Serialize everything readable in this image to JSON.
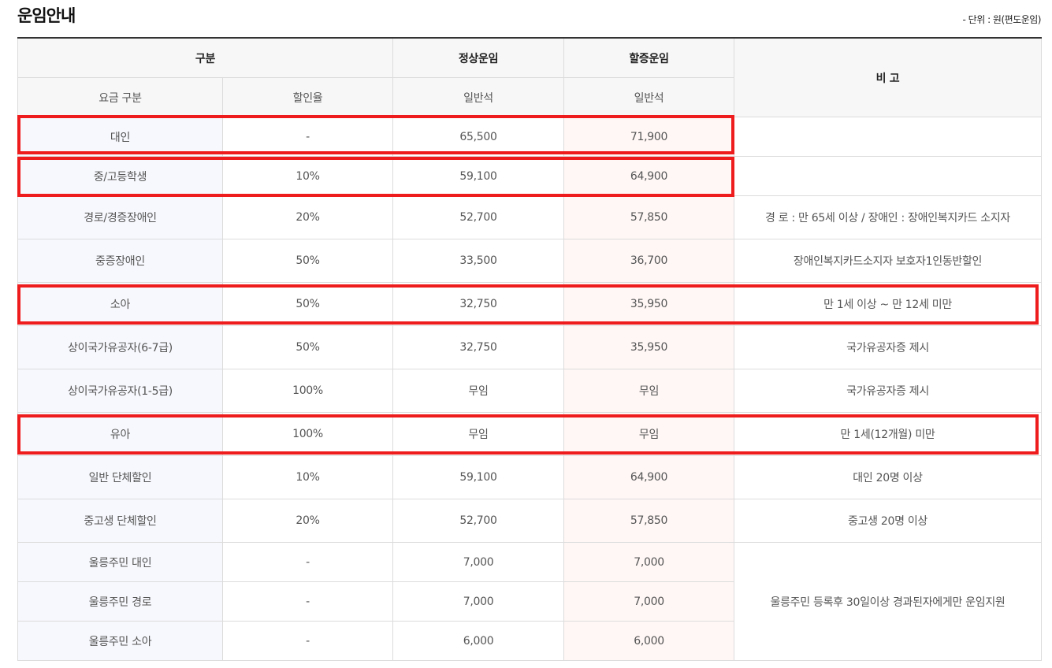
{
  "title": "운임안내",
  "unit_note": "- 단위 : 원(편도운임)",
  "headers": {
    "category": "구분",
    "normal_fare": "정상운임",
    "surge_fare": "할증운임",
    "remarks": "비 고",
    "fare_type": "요금 구분",
    "discount_rate": "할인율",
    "normal_seat": "일반석",
    "surge_seat": "일반석"
  },
  "rows": [
    {
      "type": "대인",
      "rate": "-",
      "normal": "65,500",
      "surge": "71,900",
      "note": ""
    },
    {
      "type": "중/고등학생",
      "rate": "10%",
      "normal": "59,100",
      "surge": "64,900",
      "note": ""
    },
    {
      "type": "경로/경증장애인",
      "rate": "20%",
      "normal": "52,700",
      "surge": "57,850",
      "note": "경 로 : 만 65세 이상 / 장애인 : 장애인복지카드 소지자"
    },
    {
      "type": "중증장애인",
      "rate": "50%",
      "normal": "33,500",
      "surge": "36,700",
      "note": "장애인복지카드소지자 보호자1인동반할인"
    },
    {
      "type": "소아",
      "rate": "50%",
      "normal": "32,750",
      "surge": "35,950",
      "note": "만 1세 이상 ~ 만 12세 미만"
    },
    {
      "type": "상이국가유공자(6-7급)",
      "rate": "50%",
      "normal": "32,750",
      "surge": "35,950",
      "note": "국가유공자증 제시"
    },
    {
      "type": "상이국가유공자(1-5급)",
      "rate": "100%",
      "normal": "무임",
      "surge": "무임",
      "note": "국가유공자증 제시"
    },
    {
      "type": "유아",
      "rate": "100%",
      "normal": "무임",
      "surge": "무임",
      "note": "만 1세(12개월) 미만"
    },
    {
      "type": "일반 단체할인",
      "rate": "10%",
      "normal": "59,100",
      "surge": "64,900",
      "note": "대인 20명 이상"
    },
    {
      "type": "중고생 단체할인",
      "rate": "20%",
      "normal": "52,700",
      "surge": "57,850",
      "note": "중고생 20명 이상"
    },
    {
      "type": "울릉주민 대인",
      "rate": "-",
      "normal": "7,000",
      "surge": "7,000",
      "note": "울릉주민 등록후 30일이상 경과된자에게만 운임지원"
    },
    {
      "type": "울릉주민 경로",
      "rate": "-",
      "normal": "7,000",
      "surge": "7,000"
    },
    {
      "type": "울릉주민 소아",
      "rate": "-",
      "normal": "6,000",
      "surge": "6,000"
    }
  ],
  "highlight_color": "#ee1c1c"
}
